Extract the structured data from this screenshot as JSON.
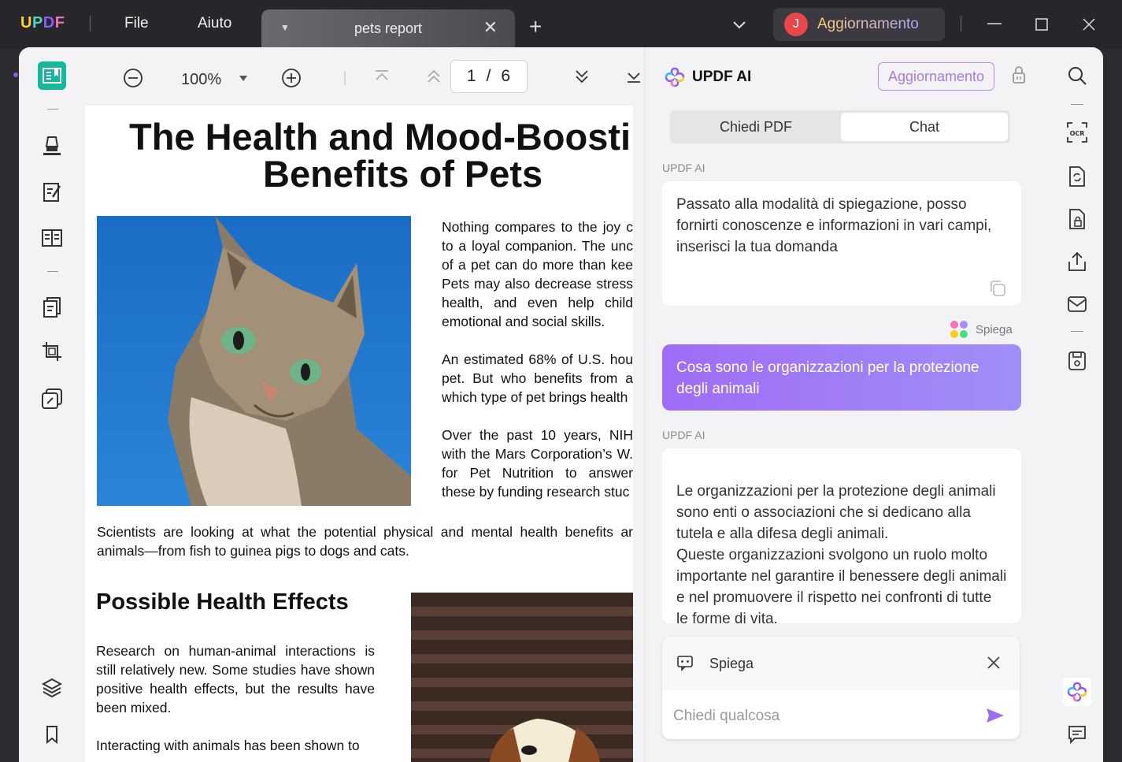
{
  "app": {
    "logo_text": "UPDF",
    "menu": [
      "File",
      "Aiuto"
    ],
    "tab_title": "pets report",
    "user_initial": "J",
    "upgrade_label": "Aggiornamento"
  },
  "toolbar": {
    "zoom": "100%",
    "current_page": "1",
    "page_separator": "/",
    "total_pages": "6"
  },
  "document": {
    "title_line1": "The Health and Mood-Boostin",
    "title_line2": "Benefits of Pets",
    "para1": "Nothing compares to the joy c to a loyal companion. The unc of a pet can do more than kee Pets may also decrease stress health, and even help child emotional and social skills.",
    "para2": "An estimated 68% of U.S. hou pet. But who benefits from a which type of pet brings health",
    "para3": "Over the past 10 years, NIH with the Mars Corporation’s W. for Pet Nutrition to answer these by funding research stuc",
    "para4": "Scientists are looking at what the potential physical and mental health benefits ar animals—from fish to guinea pigs to dogs and cats.",
    "heading2": "Possible Health Effects",
    "para5": "Research on human-animal interactions is still relatively new. Some studies have shown positive health effects, but the results have been mixed.",
    "para6": "Interacting with animals has been shown to"
  },
  "ai": {
    "title": "UPDF AI",
    "upgrade_label": "Aggiornamento",
    "tabs": [
      "Chiedi PDF",
      "Chat"
    ],
    "selected_tab": "Chat",
    "sender_label": "UPDF AI",
    "msg1": "Passato alla modalità di spiegazione, posso fornirti conoscenze e informazioni in vari campi, inserisci la tua domanda",
    "mode_tag": "Spiega",
    "user_msg": "Cosa sono le organizzazioni per la protezione degli animali",
    "msg2": "Le organizzazioni per la protezione degli animali sono enti o associazioni che si dedicano alla tutela e alla difesa degli animali.\nQueste organizzazioni svolgono un ruolo molto importante nel garantire il benessere degli animali e nel promuovere il rispetto nei confronti di tutte le forme di vita.\nAttraverso varie attività, come campagne di",
    "input_mode": "Spiega",
    "input_placeholder": "Chiedi qualcosa"
  },
  "colors": {
    "accent_teal": "#15b89a",
    "accent_purple": "#9f6cf6",
    "titlebar": "#26262b"
  },
  "icons": {
    "left_rail": [
      "reader-icon",
      "highlighter-icon",
      "edit-pdf-icon",
      "organize-pages-icon",
      "page-tools-icon",
      "crop-icon",
      "protect-icon",
      "layers-icon",
      "bookmark-icon"
    ],
    "right_rail": [
      "search-icon",
      "ocr-icon",
      "convert-icon",
      "protect-file-icon",
      "share-icon",
      "mail-icon",
      "save-icon",
      "updf-ai-icon",
      "comment-icon"
    ]
  }
}
